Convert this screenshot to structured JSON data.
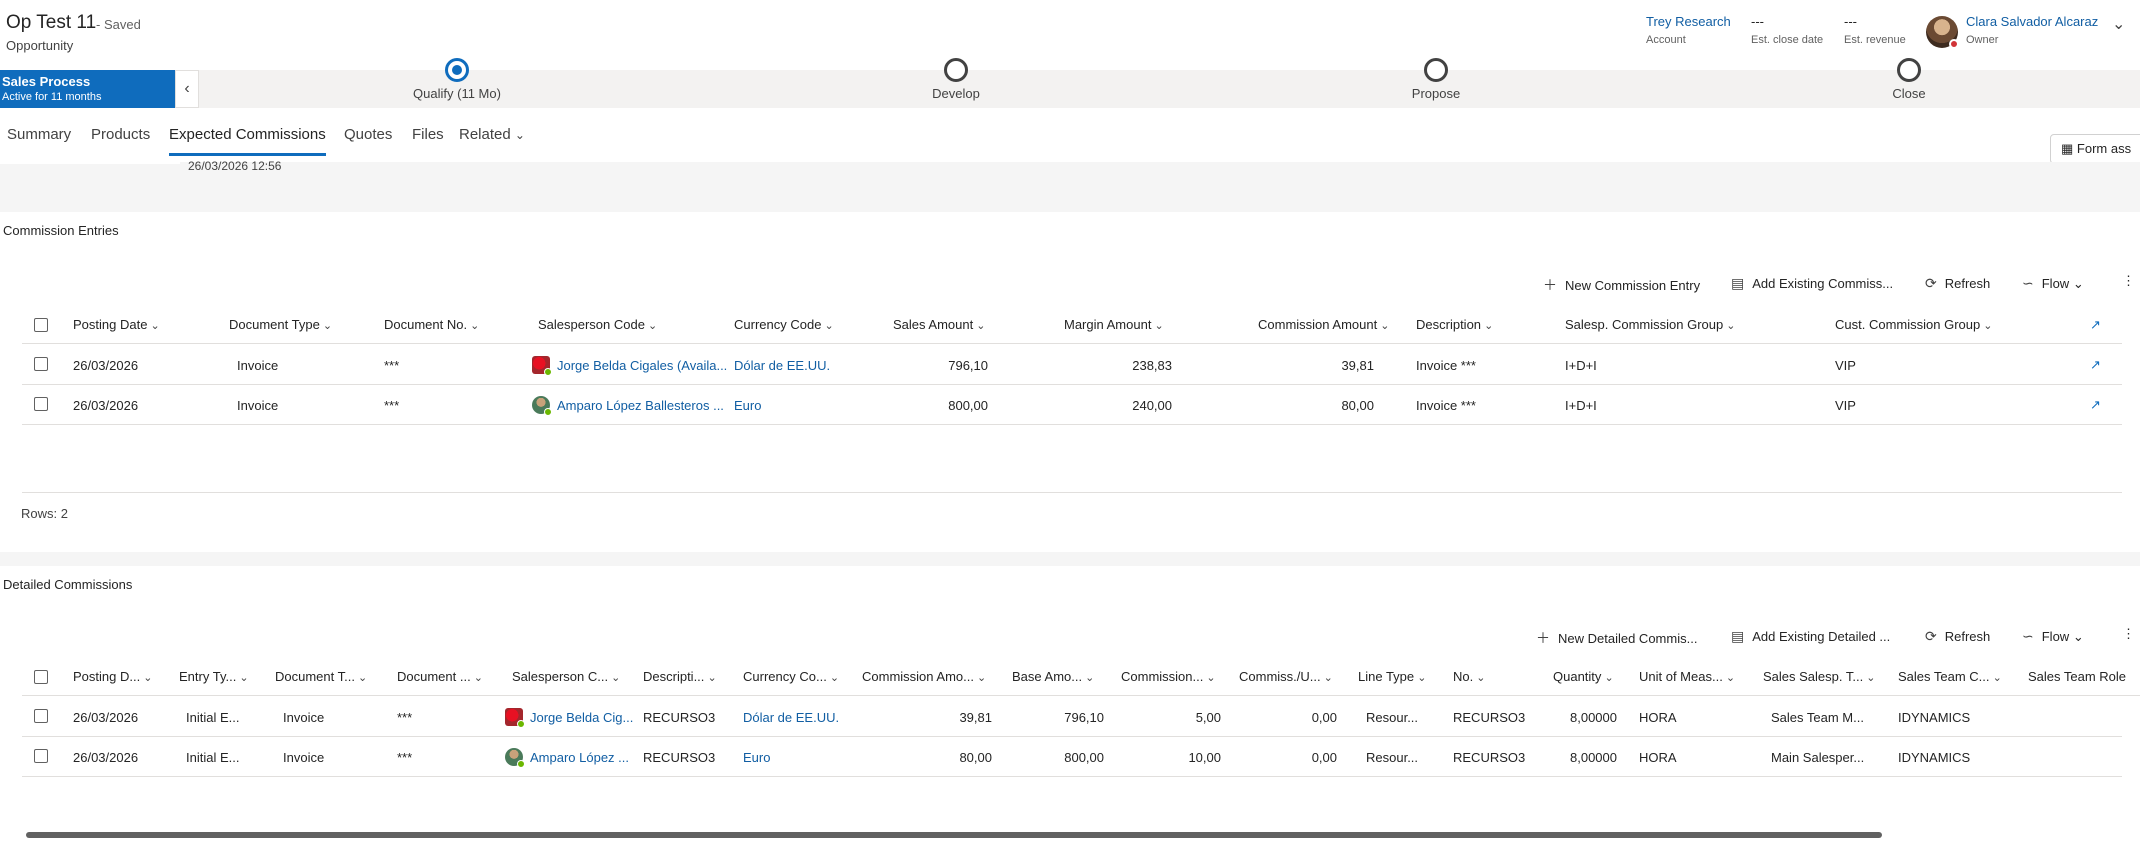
{
  "header": {
    "title": "Op Test 11",
    "saved": "- Saved",
    "entity": "Opportunity",
    "account": {
      "value": "Trey Research",
      "label": "Account"
    },
    "close_date": {
      "value": "---",
      "label": "Est. close date"
    },
    "revenue": {
      "value": "---",
      "label": "Est. revenue"
    },
    "owner": {
      "value": "Clara Salvador Alcaraz",
      "label": "Owner"
    }
  },
  "bpf": {
    "name": "Sales Process",
    "active_for": "Active for 11 months",
    "stages": [
      "Qualify  (11 Mo)",
      "Develop",
      "Propose",
      "Close"
    ]
  },
  "tabs": [
    "Summary",
    "Products",
    "Expected Commissions",
    "Quotes",
    "Files",
    "Related"
  ],
  "form_assist": "Form ass",
  "partial_field": "26/03/2026 12:56",
  "commission_entries": {
    "title": "Commission Entries",
    "commands": {
      "new": "New Commission Entry",
      "add": "Add Existing Commiss...",
      "refresh": "Refresh",
      "flow": "Flow"
    },
    "columns": [
      "Posting Date",
      "Document Type",
      "Document No.",
      "Salesperson Code",
      "Currency Code",
      "Sales Amount",
      "Margin Amount",
      "Commission Amount",
      "Description",
      "Salesp. Commission Group",
      "Cust. Commission Group"
    ],
    "rows": [
      [
        "26/03/2026",
        "Invoice",
        "***",
        "Jorge Belda Cigales (Availa...",
        "Dólar de EE.UU.",
        "796,10",
        "238,83",
        "39,81",
        "Invoice ***",
        "I+D+I",
        "VIP"
      ],
      [
        "26/03/2026",
        "Invoice",
        "***",
        "Amparo López Ballesteros ...",
        "Euro",
        "800,00",
        "240,00",
        "80,00",
        "Invoice ***",
        "I+D+I",
        "VIP"
      ]
    ],
    "rows_count": "Rows: 2"
  },
  "detailed_commissions": {
    "title": "Detailed Commissions",
    "commands": {
      "new": "New Detailed Commis...",
      "add": "Add Existing Detailed ...",
      "refresh": "Refresh",
      "flow": "Flow"
    },
    "columns": [
      "Posting D...",
      "Entry Ty...",
      "Document T...",
      "Document ...",
      "Salesperson C...",
      "Descripti...",
      "Currency Co...",
      "Commission Amo...",
      "Base Amo...",
      "Commission...",
      "Commiss./U...",
      "Line Type",
      "No.",
      "Quantity",
      "Unit of Meas...",
      "Sales Salesp. T...",
      "Sales Team C...",
      "Sales Team Role"
    ],
    "rows": [
      [
        "26/03/2026",
        "Initial E...",
        "Invoice",
        "***",
        "Jorge Belda Cig...",
        "RECURSO3",
        "Dólar de EE.UU.",
        "39,81",
        "796,10",
        "5,00",
        "0,00",
        "Resour...",
        "RECURSO3",
        "8,00000",
        "HORA",
        "Sales Team M...",
        "IDYNAMICS",
        ""
      ],
      [
        "26/03/2026",
        "Initial E...",
        "Invoice",
        "***",
        "Amparo López ...",
        "RECURSO3",
        "Euro",
        "80,00",
        "800,00",
        "10,00",
        "0,00",
        "Resour...",
        "RECURSO3",
        "8,00000",
        "HORA",
        "Main Salesper...",
        "IDYNAMICS",
        ""
      ]
    ]
  }
}
